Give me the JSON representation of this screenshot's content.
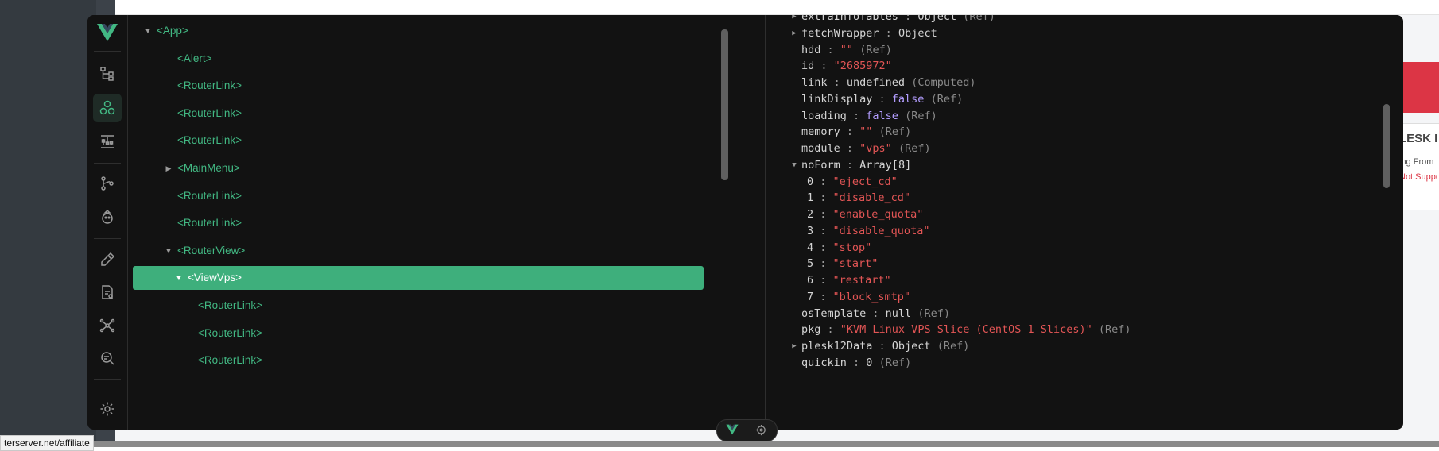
{
  "background": {
    "status_url": "terserver.net/affiliate",
    "peek_title": "LESK I",
    "peek_sub": "ing From",
    "peek_warn": "Not Suppo"
  },
  "colors": {
    "vue_green": "#42b883",
    "selected_bg": "#3eaf7c",
    "panel_bg": "#121212",
    "string": "#e25555",
    "boolean": "#b39dff",
    "alert_red": "#dc3545"
  },
  "sidebar": {
    "logo": "vue-logo-icon",
    "items": [
      {
        "icon": "component-tree-icon",
        "active": false
      },
      {
        "icon": "components-icon",
        "active": true
      },
      {
        "icon": "timeline-icon",
        "active": false
      },
      {
        "icon": "router-icon",
        "active": false
      },
      {
        "icon": "pinia-icon",
        "active": false
      },
      {
        "icon": "eyedropper-icon",
        "active": false
      },
      {
        "icon": "assets-icon",
        "active": false
      },
      {
        "icon": "graph-icon",
        "active": false
      },
      {
        "icon": "inspect-icon",
        "active": false
      }
    ],
    "settings_icon": "gear-icon"
  },
  "tree": {
    "nodes": [
      {
        "label": "<App>",
        "depth": 0,
        "arrow": "expanded",
        "selected": false
      },
      {
        "label": "<Alert>",
        "depth": 1,
        "arrow": "none",
        "selected": false
      },
      {
        "label": "<RouterLink>",
        "depth": 1,
        "arrow": "none",
        "selected": false
      },
      {
        "label": "<RouterLink>",
        "depth": 1,
        "arrow": "none",
        "selected": false
      },
      {
        "label": "<RouterLink>",
        "depth": 1,
        "arrow": "none",
        "selected": false
      },
      {
        "label": "<MainMenu>",
        "depth": 1,
        "arrow": "collapsed",
        "selected": false
      },
      {
        "label": "<RouterLink>",
        "depth": 1,
        "arrow": "none",
        "selected": false
      },
      {
        "label": "<RouterLink>",
        "depth": 1,
        "arrow": "none",
        "selected": false
      },
      {
        "label": "<RouterView>",
        "depth": 1,
        "arrow": "expanded",
        "selected": false
      },
      {
        "label": "<ViewVps>",
        "depth": 1.5,
        "arrow": "expanded",
        "selected": true
      },
      {
        "label": "<RouterLink>",
        "depth": 2,
        "arrow": "none",
        "selected": false
      },
      {
        "label": "<RouterLink>",
        "depth": 2,
        "arrow": "none",
        "selected": false
      },
      {
        "label": "<RouterLink>",
        "depth": 2,
        "arrow": "none",
        "selected": false
      }
    ]
  },
  "state": {
    "rows": [
      {
        "key": "extraInfoTables",
        "value": "Object",
        "vtype": "plain",
        "hint": "(Ref)",
        "arrow": "collapsed",
        "indent": 0
      },
      {
        "key": "fetchWrapper",
        "value": "Object",
        "vtype": "plain",
        "hint": "",
        "arrow": "collapsed",
        "indent": 0
      },
      {
        "key": "hdd",
        "value": "\"\"",
        "vtype": "str",
        "hint": "(Ref)",
        "arrow": "none",
        "indent": 0
      },
      {
        "key": "id",
        "value": "\"2685972\"",
        "vtype": "str",
        "hint": "",
        "arrow": "none",
        "indent": 0
      },
      {
        "key": "link",
        "value": "undefined",
        "vtype": "plain",
        "hint": "(Computed)",
        "arrow": "none",
        "indent": 0
      },
      {
        "key": "linkDisplay",
        "value": "false",
        "vtype": "bool",
        "hint": "(Ref)",
        "arrow": "none",
        "indent": 0
      },
      {
        "key": "loading",
        "value": "false",
        "vtype": "bool",
        "hint": "(Ref)",
        "arrow": "none",
        "indent": 0
      },
      {
        "key": "memory",
        "value": "\"\"",
        "vtype": "str",
        "hint": "(Ref)",
        "arrow": "none",
        "indent": 0
      },
      {
        "key": "module",
        "value": "\"vps\"",
        "vtype": "str",
        "hint": "(Ref)",
        "arrow": "none",
        "indent": 0
      },
      {
        "key": "noForm",
        "value": "Array[8]",
        "vtype": "plain",
        "hint": "",
        "arrow": "expanded",
        "indent": 0
      },
      {
        "key": "0",
        "value": "\"eject_cd\"",
        "vtype": "str",
        "hint": "",
        "arrow": "none",
        "indent": 1
      },
      {
        "key": "1",
        "value": "\"disable_cd\"",
        "vtype": "str",
        "hint": "",
        "arrow": "none",
        "indent": 1
      },
      {
        "key": "2",
        "value": "\"enable_quota\"",
        "vtype": "str",
        "hint": "",
        "arrow": "none",
        "indent": 1
      },
      {
        "key": "3",
        "value": "\"disable_quota\"",
        "vtype": "str",
        "hint": "",
        "arrow": "none",
        "indent": 1
      },
      {
        "key": "4",
        "value": "\"stop\"",
        "vtype": "str",
        "hint": "",
        "arrow": "none",
        "indent": 1
      },
      {
        "key": "5",
        "value": "\"start\"",
        "vtype": "str",
        "hint": "",
        "arrow": "none",
        "indent": 1
      },
      {
        "key": "6",
        "value": "\"restart\"",
        "vtype": "str",
        "hint": "",
        "arrow": "none",
        "indent": 1
      },
      {
        "key": "7",
        "value": "\"block_smtp\"",
        "vtype": "str",
        "hint": "",
        "arrow": "none",
        "indent": 1
      },
      {
        "key": "osTemplate",
        "value": "null",
        "vtype": "plain",
        "hint": "(Ref)",
        "arrow": "none",
        "indent": 0
      },
      {
        "key": "pkg",
        "value": "\"KVM Linux VPS Slice (CentOS 1 Slices)\"",
        "vtype": "str",
        "hint": "(Ref)",
        "arrow": "none",
        "indent": 0
      },
      {
        "key": "plesk12Data",
        "value": "Object",
        "vtype": "plain",
        "hint": "(Ref)",
        "arrow": "collapsed",
        "indent": 0
      },
      {
        "key": "quickin",
        "value": "0",
        "vtype": "plain",
        "hint": "(Ref)",
        "arrow": "none",
        "indent": 0
      }
    ]
  },
  "bottom_pill": {
    "left_icon": "vue-logo-icon",
    "right_icon": "crosshair-icon"
  }
}
